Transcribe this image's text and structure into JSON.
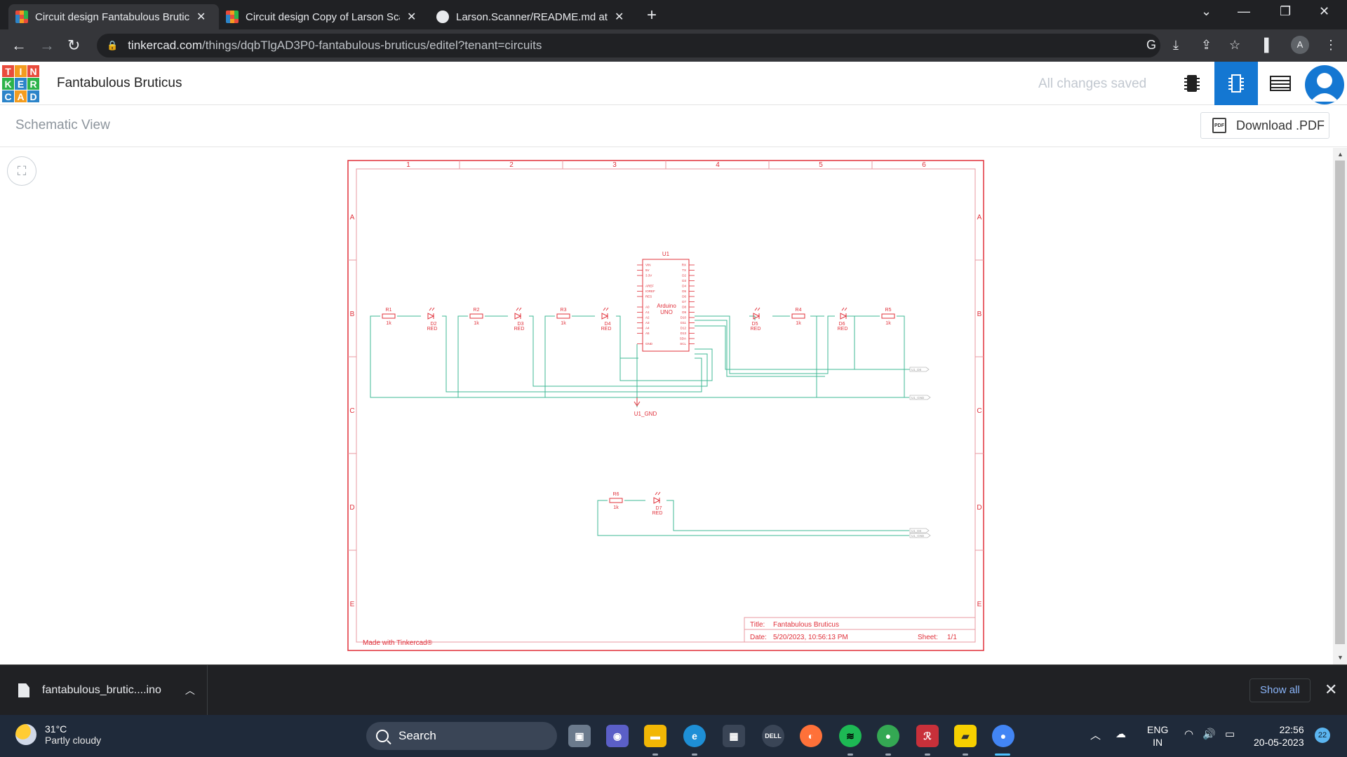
{
  "browser": {
    "tabs": [
      {
        "title": "Circuit design Fantabulous Brutic",
        "active": true
      },
      {
        "title": "Circuit design Copy of Larson Sca",
        "active": false
      },
      {
        "title": "Larson.Scanner/README.md at m",
        "active": false
      }
    ],
    "url_host": "tinkercad.com",
    "url_path": "/things/dqbTlgAD3P0-fantabulous-bruticus/editel?tenant=circuits",
    "profile_initial": "A"
  },
  "app": {
    "logo_letters": [
      "T",
      "I",
      "N",
      "K",
      "E",
      "R",
      "C",
      "A",
      "D"
    ],
    "design_title": "Fantabulous Bruticus",
    "save_status": "All changes saved",
    "schematic_label": "Schematic View",
    "download_label": "Download .PDF"
  },
  "schematic": {
    "columns": [
      "1",
      "2",
      "3",
      "4",
      "5",
      "6"
    ],
    "rows": [
      "A",
      "B",
      "C",
      "D",
      "E"
    ],
    "arduino_ref": "U1",
    "arduino_name_1": "Arduino",
    "arduino_name_2": "UNO",
    "left_pins": [
      "VIN",
      "5V",
      "3.3V",
      "",
      "AREF",
      "IOREF",
      "RES",
      "",
      "A0",
      "A1",
      "A2",
      "A3",
      "A4",
      "A5",
      "",
      "GND"
    ],
    "right_pins": [
      "RX",
      "TX",
      "D2",
      "D3",
      "D4",
      "D5",
      "D6",
      "D7",
      "D8",
      "D9",
      "D10",
      "D11",
      "D12",
      "D13",
      "SDA",
      "SCL"
    ],
    "resistors": [
      {
        "ref": "R1",
        "value": "1k"
      },
      {
        "ref": "R2",
        "value": "1k"
      },
      {
        "ref": "R3",
        "value": "1k"
      },
      {
        "ref": "R4",
        "value": "1k"
      },
      {
        "ref": "R5",
        "value": "1k"
      },
      {
        "ref": "R6",
        "value": "1k"
      }
    ],
    "leds": [
      {
        "ref": "D2",
        "color": "RED"
      },
      {
        "ref": "D3",
        "color": "RED"
      },
      {
        "ref": "D4",
        "color": "RED"
      },
      {
        "ref": "D5",
        "color": "RED"
      },
      {
        "ref": "D6",
        "color": "RED"
      },
      {
        "ref": "D7",
        "color": "RED"
      }
    ],
    "gnd_label": "U1_GND",
    "net_labels": [
      "U1_D8",
      "U1_GND",
      "U1_D8",
      "U1_GND"
    ],
    "footer_made_with": "Made with Tinkercad®",
    "title_key": "Title:",
    "title_value": "Fantabulous Bruticus",
    "date_key": "Date:",
    "date_value": "5/20/2023, 10:56:13 PM",
    "sheet_key": "Sheet:",
    "sheet_value": "1/1",
    "colors": {
      "frame": "#e0303a",
      "wire": "#3fb894",
      "component": "#e0303a"
    }
  },
  "downloads": {
    "file_name": "fantabulous_brutic....ino",
    "show_all": "Show all"
  },
  "taskbar": {
    "temperature": "31°C",
    "weather_desc": "Partly cloudy",
    "search_label": "Search",
    "lang_1": "ENG",
    "lang_2": "IN",
    "time": "22:56",
    "date": "20-05-2023",
    "notification_count": "22"
  }
}
